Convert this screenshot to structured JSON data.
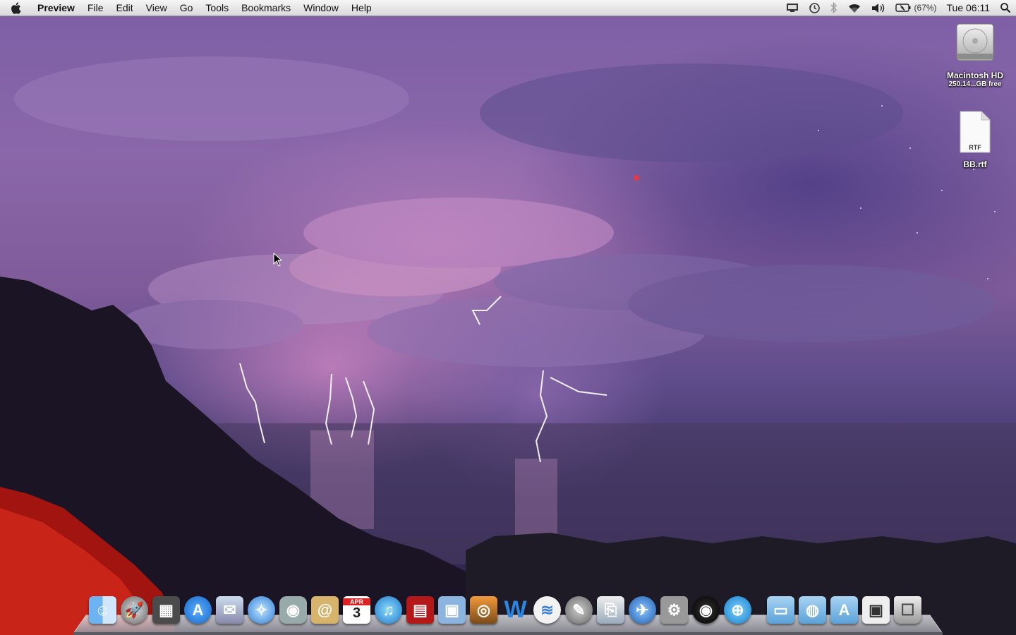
{
  "menubar": {
    "app": "Preview",
    "items": [
      "File",
      "Edit",
      "View",
      "Go",
      "Tools",
      "Bookmarks",
      "Window",
      "Help"
    ],
    "battery": "(67%)",
    "clock": "Tue 06:11"
  },
  "desktop": {
    "hd_name": "Macintosh HD",
    "hd_free": "250.14...GB free",
    "file_badge": "RTF",
    "file_name": "BB.rtf"
  },
  "dock": {
    "calendar_month": "APR",
    "calendar_day": "3",
    "apps": [
      "finder",
      "launchpad",
      "photo-booth-gallery",
      "app-store",
      "preview",
      "safari",
      "facetime",
      "address-book",
      "ical",
      "itunes",
      "photo-booth",
      "iphoto",
      "image-capture",
      "word",
      "wifi-utility",
      "script-editor",
      "preview-scanner",
      "mail",
      "system-preferences",
      "aperture",
      "network"
    ],
    "stacks": [
      "documents-folder",
      "shared-folder",
      "applications-folder",
      "screenshot-stack",
      "trash"
    ]
  }
}
